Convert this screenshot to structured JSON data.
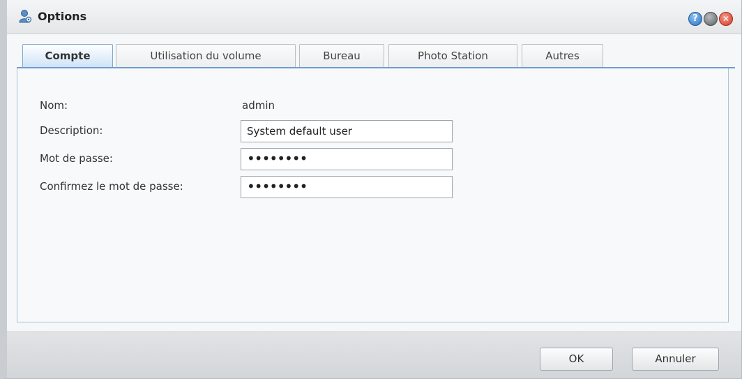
{
  "window": {
    "title": "Options",
    "title_icon": "user-settings-icon"
  },
  "title_buttons": {
    "help": "?",
    "minimize": "",
    "close": "✕"
  },
  "tabs": [
    {
      "label": "Compte",
      "active": true
    },
    {
      "label": "Utilisation du volume",
      "active": false
    },
    {
      "label": "Bureau",
      "active": false
    },
    {
      "label": "Photo Station",
      "active": false
    },
    {
      "label": "Autres",
      "active": false
    }
  ],
  "form": {
    "name_label": "Nom:",
    "name_value": "admin",
    "description_label": "Description:",
    "description_value": "System default user",
    "password_label": "Mot de passe:",
    "password_value": "••••••••",
    "confirm_label": "Confirmez le mot de passe:",
    "confirm_value": "••••••••"
  },
  "footer": {
    "ok_label": "OK",
    "cancel_label": "Annuler"
  },
  "colors": {
    "accent": "#6f9ccc",
    "active_tab": "#cfe3f7",
    "close": "#d33a25",
    "help": "#2a70c2"
  }
}
